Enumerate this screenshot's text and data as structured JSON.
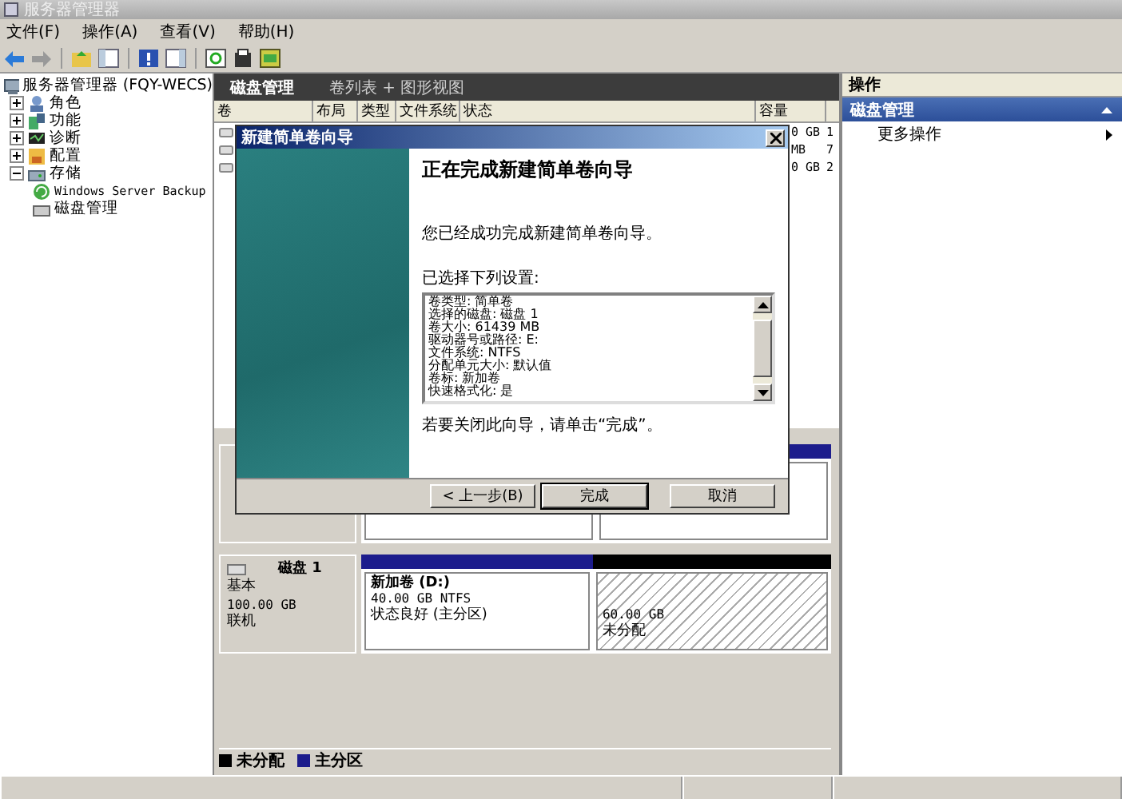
{
  "window": {
    "title": "服务器管理器"
  },
  "menu": [
    {
      "label": "文件(F)"
    },
    {
      "label": "操作(A)"
    },
    {
      "label": "查看(V)"
    },
    {
      "label": "帮助(H)"
    }
  ],
  "tree": [
    {
      "label": "服务器管理器 (FQY-WECS)",
      "kind": "root",
      "children": [
        {
          "label": "角色",
          "kind": "roles",
          "expanded": false
        },
        {
          "label": "功能",
          "kind": "features",
          "expanded": false
        },
        {
          "label": "诊断",
          "kind": "diagnostics",
          "expanded": false
        },
        {
          "label": "配置",
          "kind": "config",
          "expanded": false
        },
        {
          "label": "存储",
          "kind": "storage",
          "expanded": true,
          "children": [
            {
              "label": "Windows Server Backup",
              "kind": "backup"
            },
            {
              "label": "磁盘管理",
              "kind": "disk"
            }
          ]
        }
      ]
    }
  ],
  "center": {
    "title": "磁盘管理",
    "view": "卷列表 + 图形视图",
    "table": {
      "columns": [
        "卷",
        "布局",
        "类型",
        "文件系统",
        "状态",
        "容量"
      ],
      "rows": [
        {
          "capacity": "0 GB",
          "column_7": "1"
        },
        {
          "capacity": "MB",
          "column_7": "7"
        },
        {
          "capacity": "0 GB",
          "column_7": "2"
        }
      ]
    },
    "disks": [
      {
        "name": "磁盘 1",
        "type": "基本",
        "size": "100.00 GB",
        "status": "联机",
        "partitions": [
          {
            "kind": "primary",
            "name": "新加卷  (D:)",
            "detail": "40.00 GB NTFS",
            "status": "状态良好 (主分区)"
          },
          {
            "kind": "unallocated",
            "detail": "60.00 GB",
            "status": "未分配"
          }
        ]
      }
    ],
    "legend": [
      {
        "label": "未分配",
        "color": "#000000"
      },
      {
        "label": "主分区",
        "color": "#1c1c8c"
      }
    ]
  },
  "actions": {
    "title": "操作",
    "section": "磁盘管理",
    "items": [
      "更多操作"
    ]
  },
  "dialog": {
    "title": "新建简单卷向导",
    "heading": "正在完成新建简单卷向导",
    "intro": "您已经成功完成新建简单卷向导。",
    "settings_label": "已选择下列设置:",
    "settings": [
      "卷类型: 简单卷",
      "选择的磁盘: 磁盘 1",
      "卷大小: 61439 MB",
      "驱动器号或路径: E:",
      "文件系统: NTFS",
      "分配单元大小: 默认值",
      "卷标: 新加卷",
      "快速格式化: 是"
    ],
    "closing": "若要关闭此向导，请单击“完成”。",
    "buttons": [
      {
        "label": "< 上一步(B)",
        "default": false
      },
      {
        "label": "完成",
        "default": true
      },
      {
        "label": "取消",
        "default": false
      }
    ]
  }
}
